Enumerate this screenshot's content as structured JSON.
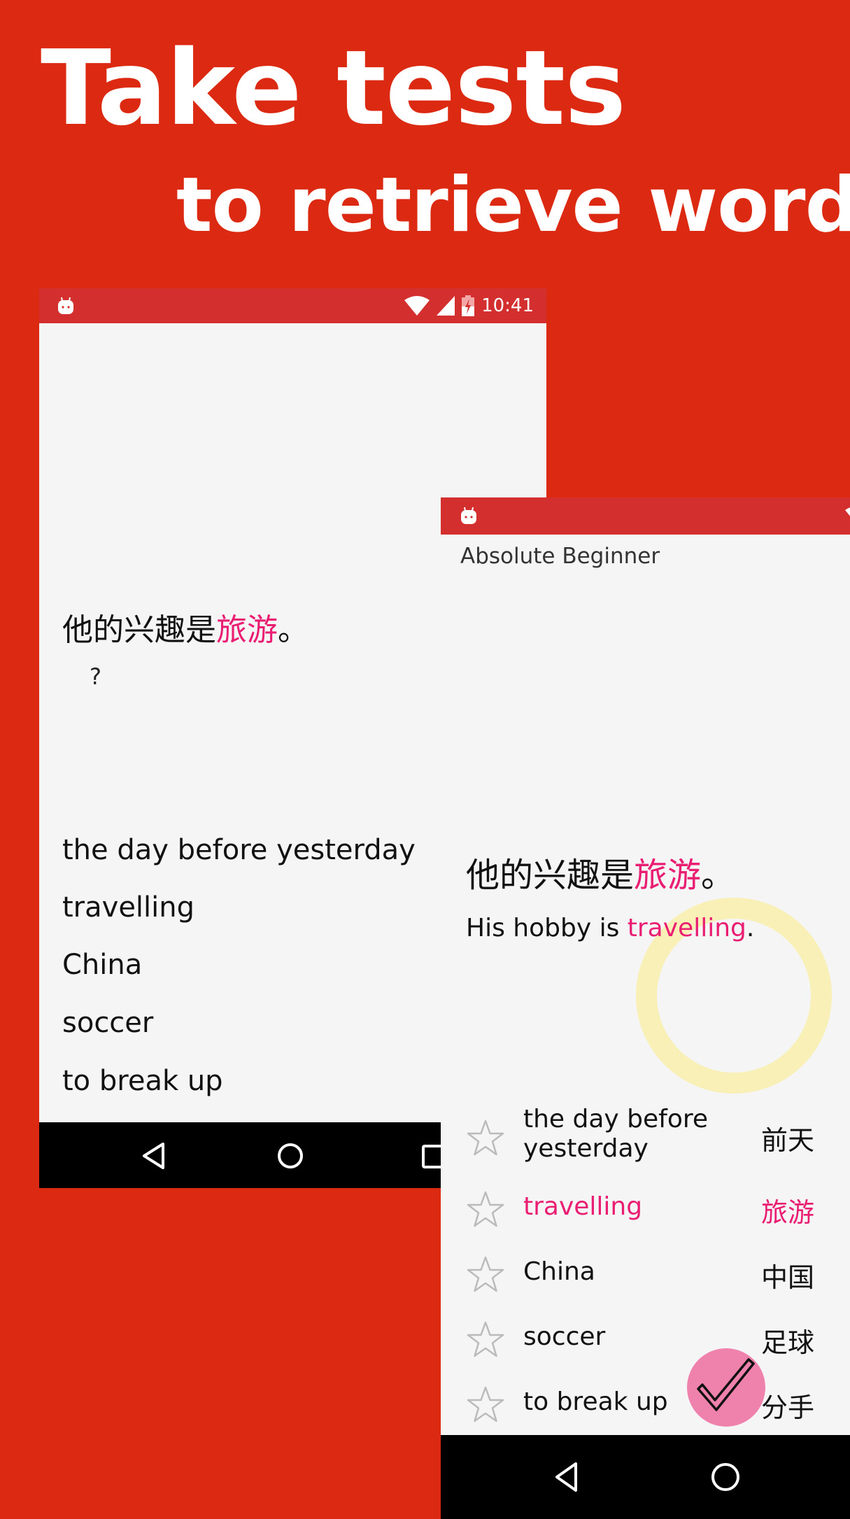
{
  "headline": {
    "line1": "Take tests",
    "line2": "to retrieve words"
  },
  "colors": {
    "background": "#dc2a12",
    "status_bar": "#d32f2f",
    "highlight": "#e91e73",
    "check_button": "#ee82ad",
    "ring": "#f8eeaa"
  },
  "back_phone": {
    "status_bar": {
      "app_icon": "android-icon",
      "wifi_icon": "wifi-icon",
      "signal_icon": "signal-icon",
      "battery_icon": "battery-charging-icon",
      "time": "10:41"
    },
    "question": {
      "prefix": "他的兴趣是",
      "highlight": "旅游",
      "suffix": "。"
    },
    "prompt": "?",
    "choices": [
      "the day before yesterday",
      "travelling",
      "China",
      "soccer",
      "to break up"
    ],
    "nav": [
      "back",
      "home",
      "recents"
    ]
  },
  "front_phone": {
    "status_bar": {
      "app_icon": "android-icon"
    },
    "deck_title": "Absolute Beginner",
    "sentence_cn": {
      "prefix": "他的兴趣是",
      "highlight": "旅游",
      "suffix": "。"
    },
    "sentence_en": {
      "prefix": "His hobby is ",
      "highlight": "travelling",
      "suffix": "."
    },
    "result_indicator": "correct-ring",
    "words": [
      {
        "en": "the day before yesterday",
        "cn": "前天",
        "starred": false,
        "active": false
      },
      {
        "en": "travelling",
        "cn": "旅游",
        "starred": false,
        "active": true
      },
      {
        "en": "China",
        "cn": "中国",
        "starred": false,
        "active": false
      },
      {
        "en": "soccer",
        "cn": "足球",
        "starred": false,
        "active": false
      },
      {
        "en": "to break up",
        "cn": "分手",
        "starred": false,
        "active": false
      }
    ],
    "check_button_icon": "checkmark-icon",
    "nav": [
      "back",
      "home"
    ]
  }
}
